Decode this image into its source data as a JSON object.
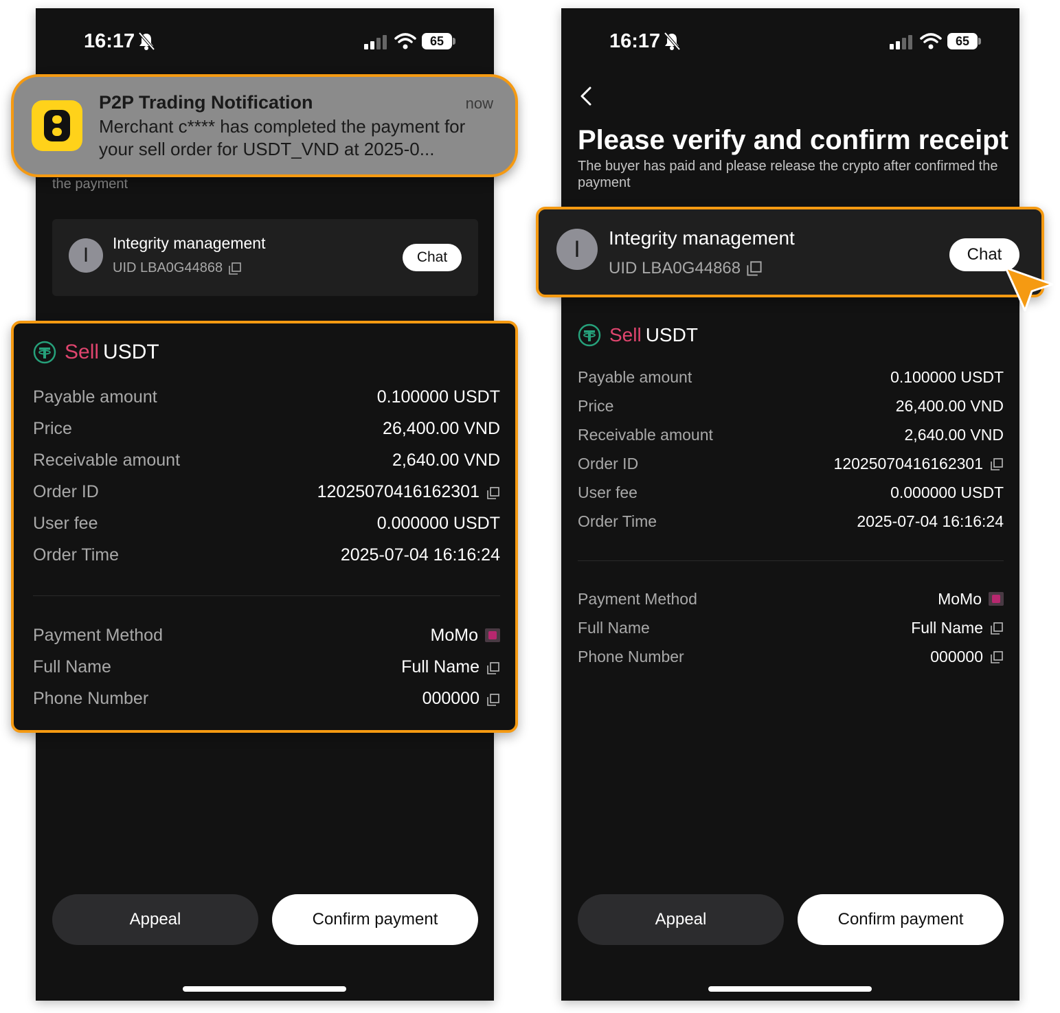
{
  "status_bar": {
    "time": "16:17",
    "battery": "65"
  },
  "header": {
    "title": "Please verify and confirm receipt",
    "subtitle": "The buyer has paid and please release the crypto after confirmed the payment",
    "subtitle_partial": "the payment"
  },
  "notification": {
    "title": "P2P Trading Notification",
    "time": "now",
    "body": "Merchant c**** has completed the payment for your sell order for USDT_VND at 2025-0..."
  },
  "merchant": {
    "avatar_letter": "I",
    "name": "Integrity management",
    "uid": "UID LBA0G44868",
    "chat_label": "Chat"
  },
  "order": {
    "side": "Sell",
    "asset": "USDT",
    "rows": [
      {
        "label": "Payable amount",
        "value": "0.100000 USDT"
      },
      {
        "label": "Price",
        "value": "26,400.00 VND"
      },
      {
        "label": "Receivable amount",
        "value": "2,640.00 VND"
      },
      {
        "label": "Order ID",
        "value": "12025070416162301"
      },
      {
        "label": "User fee",
        "value": "0.000000 USDT"
      },
      {
        "label": "Order Time",
        "value": "2025-07-04 16:16:24"
      }
    ],
    "payment_rows": [
      {
        "label": "Payment Method",
        "value": "MoMo"
      },
      {
        "label": "Full Name",
        "value": "Full Name"
      },
      {
        "label": "Phone Number",
        "value": "000000"
      }
    ]
  },
  "actions": {
    "appeal_label": "Appeal",
    "confirm_label": "Confirm payment"
  },
  "colors": {
    "highlight": "#f59a12",
    "sell": "#e0456e",
    "tether": "#26a17b",
    "background": "#121212"
  },
  "icons": [
    "bell-slash-icon",
    "signal-icon",
    "wifi-icon",
    "battery-icon",
    "back-arrow-icon",
    "copy-icon",
    "tether-icon",
    "momo-icon",
    "cursor-arrow-icon",
    "app-logo-icon"
  ]
}
